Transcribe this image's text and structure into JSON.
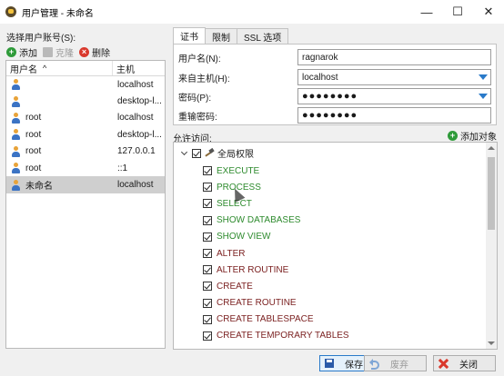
{
  "window": {
    "title": "用户管理 - 未命名",
    "minimize": "—",
    "maximize": "☐",
    "close": "✕"
  },
  "left": {
    "label": "选择用户账号(S):",
    "toolbar": {
      "add": "添加",
      "clone": "克隆",
      "delete": "删除"
    },
    "columns": {
      "user": "用户名",
      "host": "主机"
    },
    "sort_indicator": "^",
    "rows": [
      {
        "user": "",
        "host": "localhost",
        "selected": false
      },
      {
        "user": "",
        "host": "desktop-l...",
        "selected": false
      },
      {
        "user": "root",
        "host": "localhost",
        "selected": false
      },
      {
        "user": "root",
        "host": "desktop-l...",
        "selected": false
      },
      {
        "user": "root",
        "host": "127.0.0.1",
        "selected": false
      },
      {
        "user": "root",
        "host": "::1",
        "selected": false
      },
      {
        "user": "未命名",
        "host": "localhost",
        "selected": true
      }
    ]
  },
  "tabs": [
    {
      "label": "证书",
      "active": true
    },
    {
      "label": "限制",
      "active": false
    },
    {
      "label": "SSL 选项",
      "active": false
    }
  ],
  "form": {
    "username_label": "用户名(N):",
    "username_value": "ragnarok",
    "host_label": "来自主机(H):",
    "host_value": "localhost",
    "password_label": "密码(P):",
    "password_value": "●●●●●●●●",
    "repeat_label": "重输密码:",
    "repeat_value": "●●●●●●●●"
  },
  "privileges": {
    "label": "允许访问:",
    "add_object": "添加对象",
    "root_label": "全局权限",
    "items": [
      {
        "label": "EXECUTE",
        "checked": true,
        "color": "green"
      },
      {
        "label": "PROCESS",
        "checked": true,
        "color": "green"
      },
      {
        "label": "SELECT",
        "checked": true,
        "color": "green"
      },
      {
        "label": "SHOW DATABASES",
        "checked": true,
        "color": "green"
      },
      {
        "label": "SHOW VIEW",
        "checked": true,
        "color": "green"
      },
      {
        "label": "ALTER",
        "checked": true,
        "color": "dark"
      },
      {
        "label": "ALTER ROUTINE",
        "checked": true,
        "color": "dark"
      },
      {
        "label": "CREATE",
        "checked": true,
        "color": "dark"
      },
      {
        "label": "CREATE ROUTINE",
        "checked": true,
        "color": "dark"
      },
      {
        "label": "CREATE TABLESPACE",
        "checked": true,
        "color": "dark"
      },
      {
        "label": "CREATE TEMPORARY TABLES",
        "checked": true,
        "color": "dark"
      }
    ]
  },
  "buttons": {
    "save": "保存",
    "discard": "废弃",
    "close": "关闭"
  },
  "colors": {
    "accent": "#2a7ac9",
    "green": "#2e8b2e",
    "dark": "#7a1f1f",
    "delete": "#d9382c",
    "add": "#2f9b3a"
  }
}
